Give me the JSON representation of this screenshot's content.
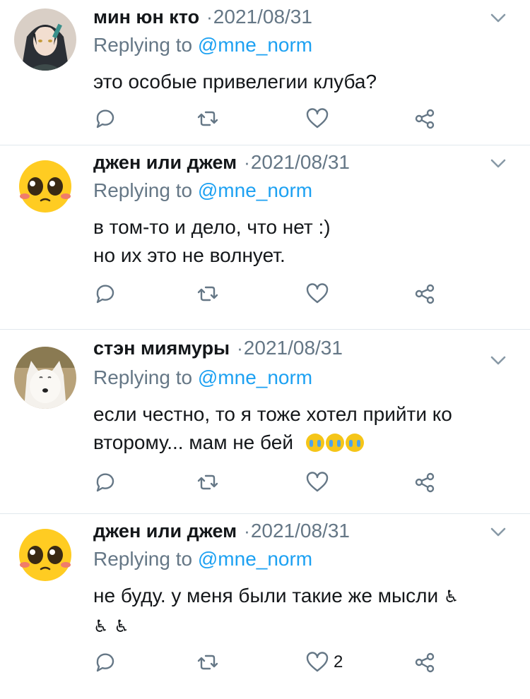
{
  "colors": {
    "accent": "#1da1f2",
    "muted": "#657786",
    "text": "#14171a",
    "divider": "#e1e8ed"
  },
  "tweets": [
    {
      "name": "мин юн кто",
      "dot": "·",
      "date": "2021/08/31",
      "reply_prefix": "Replying to",
      "reply_handle": "@mne_norm",
      "lines": [
        "это особые привелегии клуба?"
      ],
      "likes": "",
      "avatar": "anime-character-avatar"
    },
    {
      "name": "джен или джем",
      "dot": "·",
      "date": "2021/08/31",
      "reply_prefix": "Replying to",
      "reply_handle": "@mne_norm",
      "lines": [
        "в том-то и дело, что нет :)",
        "но их это не волнует."
      ],
      "likes": "",
      "avatar": "pleading-face-avatar"
    },
    {
      "name": "стэн миямуры",
      "dot": "·",
      "date": "2021/08/31",
      "reply_prefix": "Replying to",
      "reply_handle": "@mne_norm",
      "lines": [
        "если честно, то я тоже хотел прийти ко",
        "второму... мам не бей"
      ],
      "emojis": [
        "loudly-crying-face",
        "loudly-crying-face",
        "loudly-crying-face"
      ],
      "likes": "",
      "avatar": "white-wolf-avatar"
    },
    {
      "name": "джен или джем",
      "dot": "·",
      "date": "2021/08/31",
      "reply_prefix": "Replying to",
      "reply_handle": "@mne_norm",
      "lines": [
        "не буду. у меня были такие же мысли"
      ],
      "emojis": [
        "person-in-wheelchair",
        "person-in-wheelchair",
        "person-in-wheelchair"
      ],
      "likes": "2",
      "avatar": "pleading-face-avatar"
    }
  ]
}
